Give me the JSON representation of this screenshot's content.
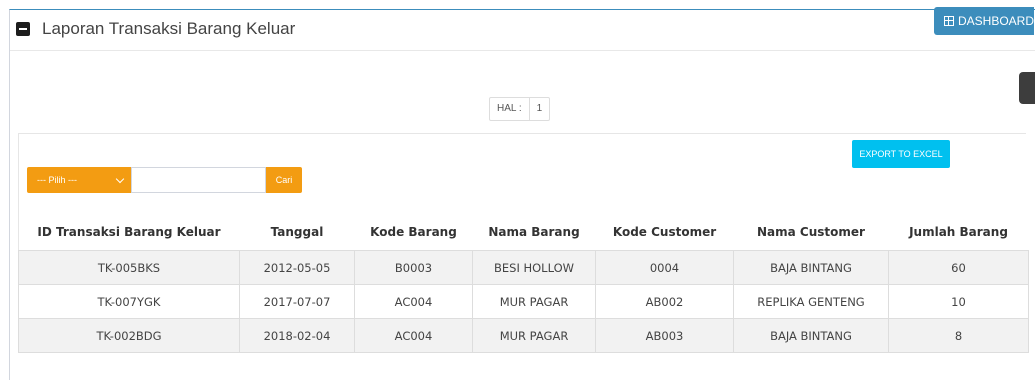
{
  "header": {
    "title": "Laporan Transaksi Barang Keluar",
    "dashboard_label": "DASHBOARD"
  },
  "pager": {
    "label": "HAL :",
    "page": "1"
  },
  "toolbar": {
    "export_label": "EXPORT TO EXCEL",
    "select_value": "--- Pilih ---",
    "search_value": "",
    "search_button": "Cari"
  },
  "table": {
    "columns": [
      "ID Transaksi Barang Keluar",
      "Tanggal",
      "Kode Barang",
      "Nama Barang",
      "Kode Customer",
      "Nama Customer",
      "Jumlah Barang"
    ],
    "rows": [
      [
        "TK-005BKS",
        "2012-05-05",
        "B0003",
        "BESI HOLLOW",
        "0004",
        "BAJA BINTANG",
        "60"
      ],
      [
        "TK-007YGK",
        "2017-07-07",
        "AC004",
        "MUR PAGAR",
        "AB002",
        "REPLIKA GENTENG",
        "10"
      ],
      [
        "TK-002BDG",
        "2018-02-04",
        "AC004",
        "MUR PAGAR",
        "AB003",
        "BAJA BINTANG",
        "8"
      ]
    ]
  },
  "colors": {
    "primary": "#3c8dbc",
    "warning": "#f39c12",
    "info": "#00c0ef"
  }
}
